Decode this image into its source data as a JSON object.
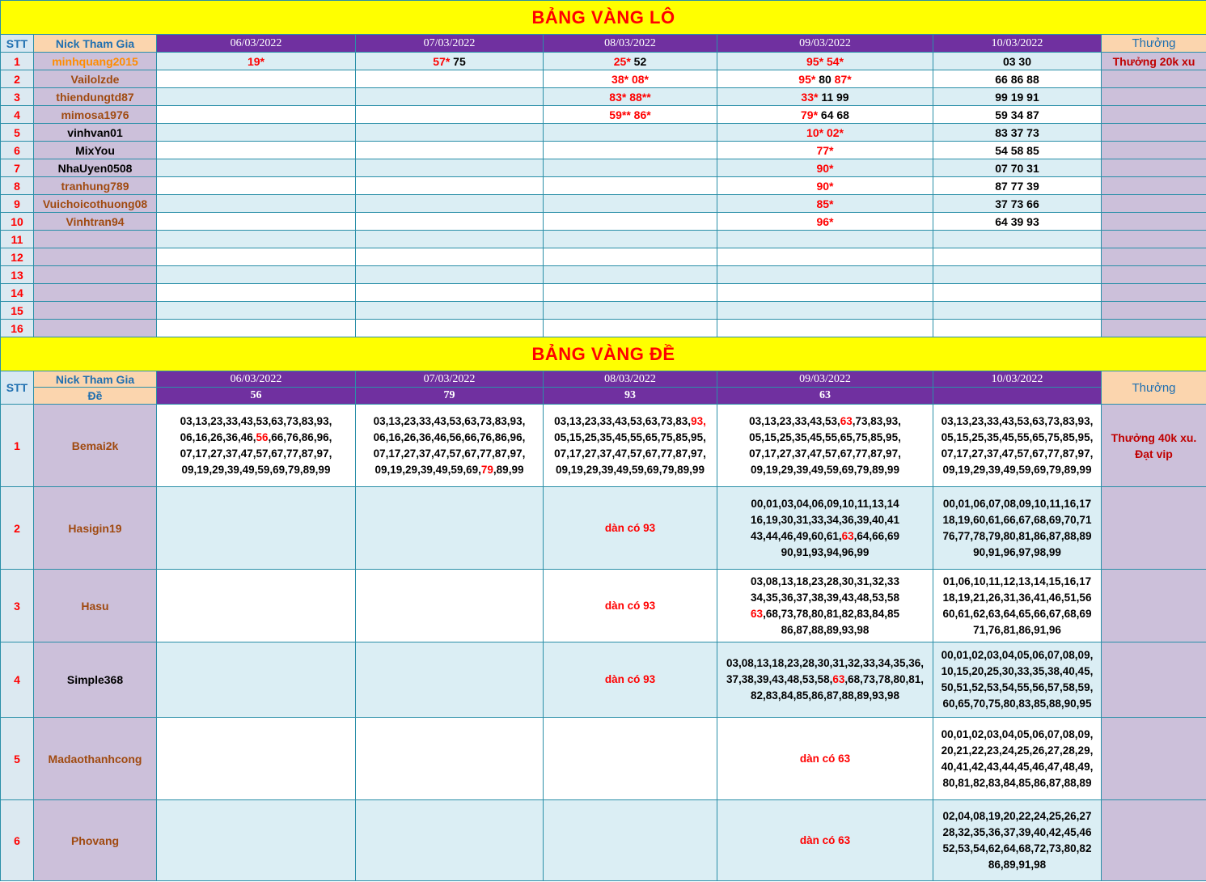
{
  "lo": {
    "title": "BẢNG VÀNG LÔ",
    "header": {
      "stt": "STT",
      "nick": "Nick Tham Gia",
      "dates": [
        "06/03/2022",
        "07/03/2022",
        "08/03/2022",
        "09/03/2022",
        "10/03/2022"
      ],
      "thuong": "Thưởng"
    },
    "rows": [
      {
        "stt": "1",
        "nick": "minhquang2015",
        "nick_color": "orange",
        "cells": [
          [
            {
              "t": "19*",
              "r": true
            }
          ],
          [
            {
              "t": "57*",
              "r": true
            },
            {
              "t": " 75",
              "r": false
            }
          ],
          [
            {
              "t": "25*",
              "r": true
            },
            {
              "t": " 52",
              "r": false
            }
          ],
          [
            {
              "t": "95* 54*",
              "r": true
            }
          ],
          [
            {
              "t": "03 30",
              "r": false
            }
          ]
        ],
        "prize": "Thưởng 20k xu"
      },
      {
        "stt": "2",
        "nick": "Vailolzde",
        "nick_color": "brown",
        "cells": [
          [],
          [],
          [
            {
              "t": "38* 08*",
              "r": true
            }
          ],
          [
            {
              "t": "95*",
              "r": true
            },
            {
              "t": " 80 ",
              "r": false
            },
            {
              "t": "87*",
              "r": true
            }
          ],
          [
            {
              "t": "66 86 88",
              "r": false
            }
          ]
        ],
        "prize": ""
      },
      {
        "stt": "3",
        "nick": "thiendungtd87",
        "nick_color": "brown",
        "cells": [
          [],
          [],
          [
            {
              "t": "83* 88**",
              "r": true
            }
          ],
          [
            {
              "t": "33*",
              "r": true
            },
            {
              "t": " 11 99",
              "r": false
            }
          ],
          [
            {
              "t": "99 19 91",
              "r": false
            }
          ]
        ],
        "prize": ""
      },
      {
        "stt": "4",
        "nick": "mimosa1976",
        "nick_color": "brown",
        "cells": [
          [],
          [],
          [
            {
              "t": "59** 86*",
              "r": true
            }
          ],
          [
            {
              "t": "79*",
              "r": true
            },
            {
              "t": " 64 68",
              "r": false
            }
          ],
          [
            {
              "t": "59 34 87",
              "r": false
            }
          ]
        ],
        "prize": ""
      },
      {
        "stt": "5",
        "nick": "vinhvan01",
        "nick_color": "black",
        "cells": [
          [],
          [],
          [],
          [
            {
              "t": "10* 02*",
              "r": true
            }
          ],
          [
            {
              "t": "83 37 73",
              "r": false
            }
          ]
        ],
        "prize": ""
      },
      {
        "stt": "6",
        "nick": "MixYou",
        "nick_color": "black",
        "cells": [
          [],
          [],
          [],
          [
            {
              "t": "77*",
              "r": true
            }
          ],
          [
            {
              "t": "54 58 85",
              "r": false
            }
          ]
        ],
        "prize": ""
      },
      {
        "stt": "7",
        "nick": "NhaUyen0508",
        "nick_color": "black",
        "cells": [
          [],
          [],
          [],
          [
            {
              "t": "90*",
              "r": true
            }
          ],
          [
            {
              "t": "07 70 31",
              "r": false
            }
          ]
        ],
        "prize": ""
      },
      {
        "stt": "8",
        "nick": "tranhung789",
        "nick_color": "brown",
        "cells": [
          [],
          [],
          [],
          [
            {
              "t": "90*",
              "r": true
            }
          ],
          [
            {
              "t": "87 77 39",
              "r": false
            }
          ]
        ],
        "prize": ""
      },
      {
        "stt": "9",
        "nick": "Vuichoicothuong08",
        "nick_color": "brown",
        "cells": [
          [],
          [],
          [],
          [
            {
              "t": "85*",
              "r": true
            }
          ],
          [
            {
              "t": "37 73 66",
              "r": false
            }
          ]
        ],
        "prize": ""
      },
      {
        "stt": "10",
        "nick": "Vinhtran94",
        "nick_color": "brown",
        "cells": [
          [],
          [],
          [],
          [
            {
              "t": "96*",
              "r": true
            }
          ],
          [
            {
              "t": "64 39 93",
              "r": false
            }
          ]
        ],
        "prize": ""
      },
      {
        "stt": "11",
        "nick": "",
        "nick_color": "black",
        "cells": [
          [],
          [],
          [],
          [],
          []
        ],
        "prize": ""
      },
      {
        "stt": "12",
        "nick": "",
        "nick_color": "black",
        "cells": [
          [],
          [],
          [],
          [],
          []
        ],
        "prize": ""
      },
      {
        "stt": "13",
        "nick": "",
        "nick_color": "black",
        "cells": [
          [],
          [],
          [],
          [],
          []
        ],
        "prize": ""
      },
      {
        "stt": "14",
        "nick": "",
        "nick_color": "black",
        "cells": [
          [],
          [],
          [],
          [],
          []
        ],
        "prize": ""
      },
      {
        "stt": "15",
        "nick": "",
        "nick_color": "black",
        "cells": [
          [],
          [],
          [],
          [],
          []
        ],
        "prize": ""
      },
      {
        "stt": "16",
        "nick": "",
        "nick_color": "black",
        "cells": [
          [],
          [],
          [],
          [],
          []
        ],
        "prize": ""
      }
    ]
  },
  "de": {
    "title": "BẢNG VÀNG ĐỀ",
    "header": {
      "stt": "STT",
      "nick": "Nick Tham Gia",
      "de": "Đề",
      "dates": [
        "06/03/2022",
        "07/03/2022",
        "08/03/2022",
        "09/03/2022",
        "10/03/2022"
      ],
      "results": [
        "56",
        "79",
        "93",
        "63",
        ""
      ],
      "thuong": "Thưởng"
    },
    "rows": [
      {
        "stt": "1",
        "nick": "Bemai2k",
        "nick_color": "brown",
        "cells": [
          [
            {
              "t": "03,13,23,33,43,53,63,73,83,93, 06,16,26,36,46,",
              "r": false
            },
            {
              "t": "56",
              "r": true
            },
            {
              "t": ",66,76,86,96, 07,17,27,37,47,57,67,77,87,97, 09,19,29,39,49,59,69,79,89,99",
              "r": false
            }
          ],
          [
            {
              "t": "03,13,23,33,43,53,63,73,83,93, 06,16,26,36,46,56,66,76,86,96, 07,17,27,37,47,57,67,77,87,97, 09,19,29,39,49,59,69,",
              "r": false
            },
            {
              "t": "79",
              "r": true
            },
            {
              "t": ",89,99",
              "r": false
            }
          ],
          [
            {
              "t": "03,13,23,33,43,53,63,73,83,",
              "r": false
            },
            {
              "t": "93,",
              "r": true
            },
            {
              "t": " 05,15,25,35,45,55,65,75,85,95, 07,17,27,37,47,57,67,77,87,97, 09,19,29,39,49,59,69,79,89,99",
              "r": false
            }
          ],
          [
            {
              "t": "03,13,23,33,43,53,",
              "r": false
            },
            {
              "t": "63",
              "r": true
            },
            {
              "t": ",73,83,93, 05,15,25,35,45,55,65,75,85,95, 07,17,27,37,47,57,67,77,87,97, 09,19,29,39,49,59,69,79,89,99",
              "r": false
            }
          ],
          [
            {
              "t": "03,13,23,33,43,53,63,73,83,93, 05,15,25,35,45,55,65,75,85,95, 07,17,27,37,47,57,67,77,87,97, 09,19,29,39,49,59,69,79,89,99",
              "r": false
            }
          ]
        ],
        "prize": "Thưởng 40k xu. Đạt vip"
      },
      {
        "stt": "2",
        "nick": "Hasigin19",
        "nick_color": "brown",
        "cells": [
          [],
          [],
          [
            {
              "t": "dàn có 93",
              "r": true
            }
          ],
          [
            {
              "t": "00,01,03,04,06,09,10,11,13,14 16,19,30,31,33,34,36,39,40,41 43,44,46,49,60,61,",
              "r": false
            },
            {
              "t": "63",
              "r": true
            },
            {
              "t": ",64,66,69 90,91,93,94,96,99",
              "r": false
            }
          ],
          [
            {
              "t": "00,01,06,07,08,09,10,11,16,17 18,19,60,61,66,67,68,69,70,71 76,77,78,79,80,81,86,87,88,89 90,91,96,97,98,99",
              "r": false
            }
          ]
        ],
        "prize": ""
      },
      {
        "stt": "3",
        "nick": "Hasu",
        "nick_color": "brown",
        "cells": [
          [],
          [],
          [
            {
              "t": "dàn có 93",
              "r": true
            }
          ],
          [
            {
              "t": "03,08,13,18,23,28,30,31,32,33 34,35,36,37,38,39,43,48,53,58 ",
              "r": false
            },
            {
              "t": "63",
              "r": true
            },
            {
              "t": ",68,73,78,80,81,82,83,84,85 86,87,88,89,93,98",
              "r": false
            }
          ],
          [
            {
              "t": "01,06,10,11,12,13,14,15,16,17 18,19,21,26,31,36,41,46,51,56 60,61,62,63,64,65,66,67,68,69 71,76,81,86,91,96",
              "r": false
            }
          ]
        ],
        "prize": ""
      },
      {
        "stt": "4",
        "nick": "Simple368",
        "nick_color": "black",
        "cells": [
          [],
          [],
          [
            {
              "t": "dàn có 93",
              "r": true
            }
          ],
          [
            {
              "t": "03,08,13,18,23,28,30,31,32,33,34,35,36, 37,38,39,43,48,53,58,",
              "r": false
            },
            {
              "t": "63",
              "r": true
            },
            {
              "t": ",68,73,78,80,81, 82,83,84,85,86,87,88,89,93,98",
              "r": false
            }
          ],
          [
            {
              "t": "00,01,02,03,04,05,06,07,08,09, 10,15,20,25,30,33,35,38,40,45, 50,51,52,53,54,55,56,57,58,59, 60,65,70,75,80,83,85,88,90,95",
              "r": false
            }
          ]
        ],
        "prize": ""
      },
      {
        "stt": "5",
        "nick": "Madaothanhcong",
        "nick_color": "brown",
        "cells": [
          [],
          [],
          [],
          [
            {
              "t": "dàn có 63",
              "r": true
            }
          ],
          [
            {
              "t": "00,01,02,03,04,05,06,07,08,09, 20,21,22,23,24,25,26,27,28,29, 40,41,42,43,44,45,46,47,48,49, 80,81,82,83,84,85,86,87,88,89",
              "r": false
            }
          ]
        ],
        "prize": ""
      },
      {
        "stt": "6",
        "nick": "Phovang",
        "nick_color": "brown",
        "cells": [
          [],
          [],
          [],
          [
            {
              "t": "dàn có 63",
              "r": true
            }
          ],
          [
            {
              "t": "02,04,08,19,20,22,24,25,26,27 28,32,35,36,37,39,40,42,45,46 52,53,54,62,64,68,72,73,80,82 86,89,91,98",
              "r": false
            }
          ]
        ],
        "prize": ""
      }
    ]
  }
}
